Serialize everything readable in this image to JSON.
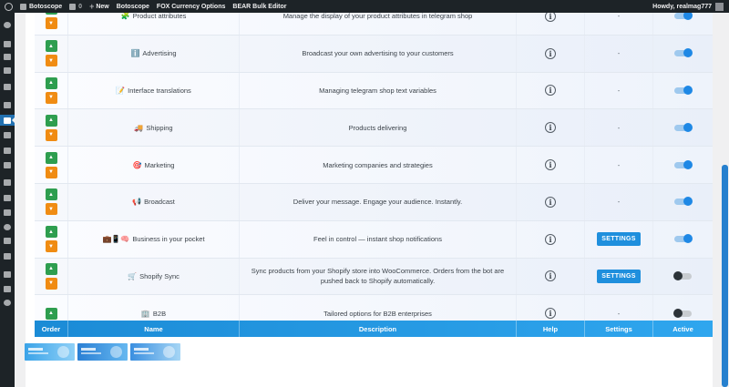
{
  "admin_bar": {
    "site_name": "Botoscope",
    "comments_count": "0",
    "new_label": "New",
    "menu_items": [
      "Botoscope",
      "FOX Currency Options",
      "BEAR Bulk Editor"
    ],
    "greeting": "Howdy, realmag777"
  },
  "table": {
    "rows": [
      {
        "icon": "🧩",
        "name": "Product attributes",
        "description": "Manage the display of your product attributes in telegram shop",
        "settings": "-",
        "active": true,
        "has_settings_button": false,
        "show_down": true
      },
      {
        "icon": "ℹ️",
        "name": "Advertising",
        "description": "Broadcast your own advertising to your customers",
        "settings": "-",
        "active": true,
        "has_settings_button": false,
        "show_down": true
      },
      {
        "icon": "📝",
        "name": "Interface translations",
        "description": "Managing telegram shop text variables",
        "settings": "-",
        "active": true,
        "has_settings_button": false,
        "show_down": true
      },
      {
        "icon": "🚚",
        "name": "Shipping",
        "description": "Products delivering",
        "settings": "-",
        "active": true,
        "has_settings_button": false,
        "show_down": true
      },
      {
        "icon": "🎯",
        "name": "Marketing",
        "description": "Marketing companies and strategies",
        "settings": "-",
        "active": true,
        "has_settings_button": false,
        "show_down": true
      },
      {
        "icon": "📢",
        "name": "Broadcast",
        "description": "Deliver your message. Engage your audience. Instantly.",
        "settings": "-",
        "active": true,
        "has_settings_button": false,
        "show_down": true
      },
      {
        "icon": "💼📱🧠",
        "name": "Business in your pocket",
        "description": "Feel in control — instant shop notifications",
        "settings": "SETTINGS",
        "active": true,
        "has_settings_button": true,
        "show_down": true
      },
      {
        "icon": "🛒",
        "name": "Shopify Sync",
        "description": "Sync products from your Shopify store into WooCommerce. Orders from the bot are pushed back to Shopify automatically.",
        "settings": "SETTINGS",
        "active": false,
        "has_settings_button": true,
        "show_down": true
      },
      {
        "icon": "🏢",
        "name": "B2B",
        "description": "Tailored options for B2B enterprises",
        "settings": "-",
        "active": false,
        "has_settings_button": false,
        "show_down": false
      }
    ],
    "headers": {
      "order": "Order",
      "name": "Name",
      "description": "Description",
      "help": "Help",
      "settings": "Settings",
      "active": "Active"
    }
  },
  "colors": {
    "accent": "#1f8fdd",
    "up_button": "#2e9e4f",
    "down_button": "#f08c13",
    "admin_bar": "#1d2327"
  }
}
